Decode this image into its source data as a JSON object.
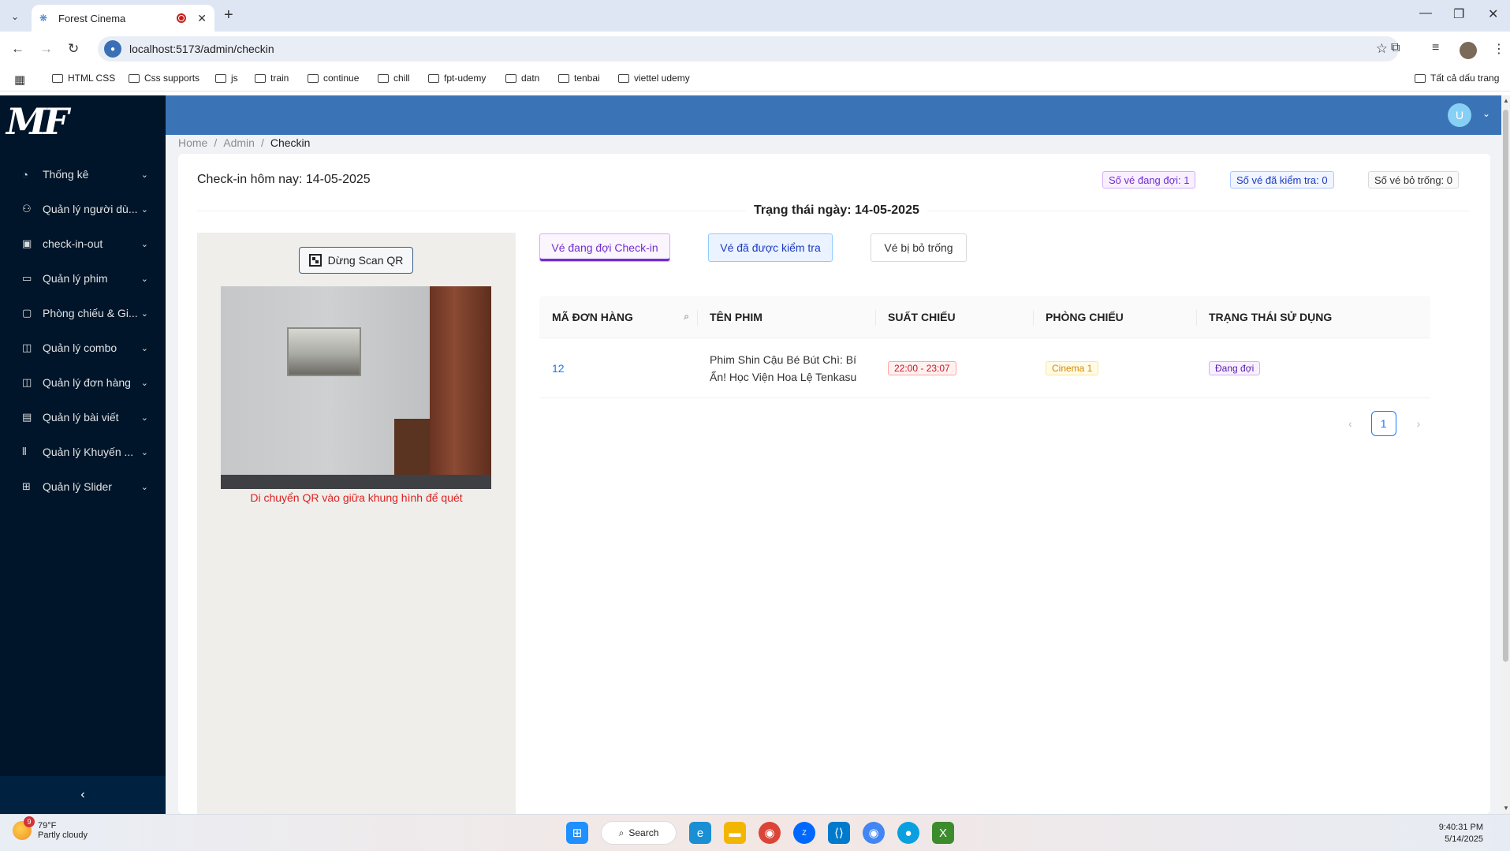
{
  "browser": {
    "tab_title": "Forest Cinema",
    "url": "localhost:5173/admin/checkin",
    "bookmarks": [
      "HTML CSS",
      "Css supports",
      "js",
      "train",
      "continue",
      "chill",
      "fpt-udemy",
      "datn",
      "tenbai",
      "viettel udemy"
    ],
    "all_bookmarks": "Tất cả dấu trang"
  },
  "sidebar": {
    "logo": "MF",
    "items": [
      {
        "label": "Thống kê",
        "icon": "dashboard-icon"
      },
      {
        "label": "Quản lý người dù...",
        "icon": "user-icon"
      },
      {
        "label": "check-in-out",
        "icon": "calendar-icon"
      },
      {
        "label": "Quản lý phim",
        "icon": "film-icon"
      },
      {
        "label": "Phòng chiếu & Gi...",
        "icon": "desktop-icon"
      },
      {
        "label": "Quản lý combo",
        "icon": "shopping-icon"
      },
      {
        "label": "Quản lý đơn hàng",
        "icon": "shopping-bag-icon"
      },
      {
        "label": "Quản lý bài viết",
        "icon": "file-icon"
      },
      {
        "label": "Quản lý Khuyến ...",
        "icon": "barcode-icon"
      },
      {
        "label": "Quản lý Slider",
        "icon": "appstore-icon"
      }
    ]
  },
  "header": {
    "avatar_letter": "U"
  },
  "breadcrumb": [
    "Home",
    "Admin",
    "Checkin"
  ],
  "checkin": {
    "title": "Check-in hôm nay: 14-05-2025",
    "count_waiting": "Số vé đang đợi: 1",
    "count_checked": "Số vé đã kiểm tra: 0",
    "count_empty": "Số vé bỏ trống: 0",
    "status_heading": "Trạng thái ngày: 14-05-2025",
    "stop_scan_label": "Dừng Scan QR",
    "scan_hint": "Di chuyển QR vào giữa khung hình để quét",
    "tabs": {
      "waiting": "Vé đang đợi Check-in",
      "checked": "Vé đã được kiểm tra",
      "empty": "Vé bị bỏ trống"
    }
  },
  "table": {
    "headers": [
      "MÃ ĐƠN HÀNG",
      "TÊN PHIM",
      "SUẤT CHIẾU",
      "PHÒNG CHIẾU",
      "TRẠNG THÁI SỬ DỤNG"
    ],
    "rows": [
      {
        "order_id": "12",
        "movie": "Phim Shin Cậu Bé Bút Chì: Bí Ẩn! Học Viện Hoa Lệ Tenkasu",
        "showtime": "22:00 - 23:07",
        "room": "Cinema 1",
        "status": "Đang đợi"
      }
    ],
    "current_page": "1"
  },
  "taskbar": {
    "temp": "79°F",
    "weather": "Partly cloudy",
    "weather_badge": "9",
    "search_label": "Search",
    "time": "9:40:31 PM",
    "date": "5/14/2025"
  }
}
